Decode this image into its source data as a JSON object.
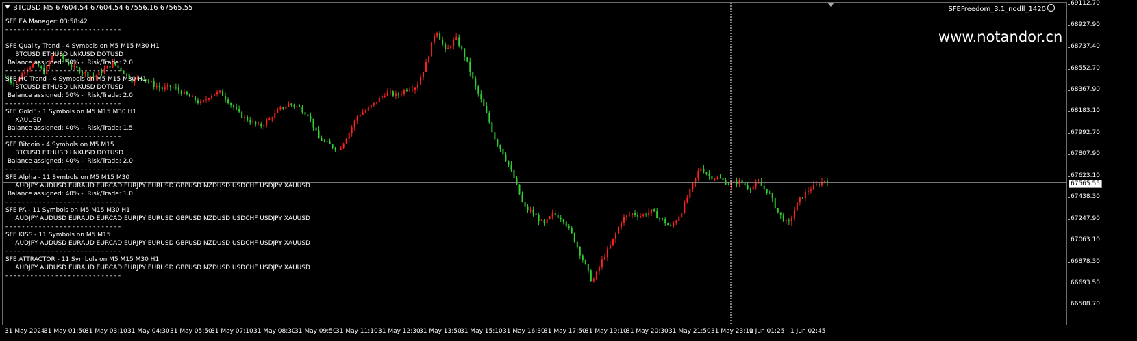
{
  "header": {
    "symbol_line": "BTCUSD,M5  67604.54 67604.54 67556.16 67565.55",
    "ea_name": "SFEFreedom_3.1_nodll_1420"
  },
  "watermark": "www.notandor.cn",
  "info_panel": [
    "SFE EA Manager: 03:58:42",
    "- - - - - - - - - - - - - - - - - - - - - - - - - - - -",
    "",
    "SFE Quality Trend - 4 Symbols on M5 M15 M30 H1",
    "     BTCUSD ETHUSD LNKUSD DOTUSD",
    " Balance assigned: 50% -  Risk/Trade: 2.0",
    "- - - - - - - - - - - - - - - - - - - - - - - - - - - -",
    "SFE HC Trend - 4 Symbols on M5 M15 M30 H1",
    "     BTCUSD ETHUSD LNKUSD DOTUSD",
    " Balance assigned: 50% -  Risk/Trade: 2.0",
    "- - - - - - - - - - - - - - - - - - - - - - - - - - - -",
    "SFE GoldF - 1 Symbols on M5 M15 M30 H1",
    "     XAUUSD",
    " Balance assigned: 40% -  Risk/Trade: 1.5",
    "- - - - - - - - - - - - - - - - - - - - - - - - - - - -",
    "SFE Bitcoin - 4 Symbols on M5 M15",
    "     BTCUSD ETHUSD LNKUSD DOTUSD",
    " Balance assigned: 40% -  Risk/Trade: 2.0",
    "- - - - - - - - - - - - - - - - - - - - - - - - - - - -",
    "SFE Alpha - 11 Symbols on M5 M15 M30",
    "     AUDJPY AUDUSD EURAUD EURCAD EURJPY EURUSD GBPUSD NZDUSD USDCHF USDJPY XAUUSD",
    " Balance assigned: 40% -  Risk/Trade: 1.0",
    "- - - - - - - - - - - - - - - - - - - - - - - - - - - -",
    "SFE PA - 11 Symbols on M5 M15 M30 H1",
    "     AUDJPY AUDUSD EURAUD EURCAD EURJPY EURUSD GBPUSD NZDUSD USDCHF USDJPY XAUUSD",
    "- - - - - - - - - - - - - - - - - - - - - - - - - - - -",
    "SFE KISS - 11 Symbols on M5 M15",
    "     AUDJPY AUDUSD EURAUD EURCAD EURJPY EURUSD GBPUSD NZDUSD USDCHF USDJPY XAUUSD",
    "- - - - - - - - - - - - - - - - - - - - - - - - - - - -",
    "SFE ATTRACTOR - 11 Symbols on M5 M15 M30 H1",
    "     AUDJPY AUDUSD EURAUD EURCAD EURJPY EURUSD GBPUSD NZDUSD USDCHF USDJPY XAUUSD",
    "- - - - - - - - - - - - - - - - - - - - - - - - - - - -"
  ],
  "price_axis": {
    "ticks": [
      "69112.70",
      "68927.90",
      "68737.40",
      "68552.70",
      "68367.90",
      "68183.10",
      "67992.70",
      "67807.90",
      "67623.10",
      "67438.30",
      "67247.90",
      "67063.10",
      "66878.30",
      "66693.50",
      "66508.70"
    ],
    "current_price": "67565.55"
  },
  "time_axis": {
    "ticks": [
      "31 May 2024",
      "31 May 01:50",
      "31 May 03:10",
      "31 May 04:30",
      "31 May 05:50",
      "31 May 07:10",
      "31 May 08:30",
      "31 May 09:50",
      "31 May 11:10",
      "31 May 12:30",
      "31 May 13:50",
      "31 May 15:10",
      "31 May 16:30",
      "31 May 17:50",
      "31 May 19:10",
      "31 May 20:30",
      "31 May 21:50",
      "31 May 23:10",
      "1 Jun 01:25",
      "1 Jun 02:45"
    ]
  },
  "chart_data": {
    "type": "candlestick",
    "symbol": "BTCUSD",
    "timeframe": "M5",
    "ylim": [
      66508.7,
      69112.7
    ],
    "colors": {
      "bull": "#ff2020",
      "bear": "#32cd32",
      "crosshair": "#ffffff",
      "grid": "#888888"
    },
    "close_path": [
      68480,
      68420,
      68550,
      68600,
      68520,
      68700,
      68630,
      68560,
      68520,
      68480,
      68540,
      68600,
      68530,
      68450,
      68480,
      68420,
      68380,
      68400,
      68350,
      68300,
      68250,
      68330,
      68350,
      68250,
      68150,
      68100,
      68050,
      68120,
      68200,
      68250,
      68220,
      68150,
      67950,
      67900,
      67850,
      67980,
      68150,
      68200,
      68280,
      68350,
      68320,
      68380,
      68400,
      68600,
      68900,
      68700,
      68820,
      68650,
      68400,
      68200,
      67950,
      67800,
      67600,
      67350,
      67300,
      67200,
      67300,
      67250,
      67100,
      66900,
      66700,
      66900,
      67050,
      67250,
      67300,
      67280,
      67320,
      67250,
      67180,
      67300,
      67500,
      67700,
      67620,
      67600,
      67550,
      67580,
      67520,
      67560,
      67480,
      67300,
      67200,
      67400,
      67500,
      67550,
      67600
    ],
    "last_ohlc": {
      "open": 67604.54,
      "high": 67604.54,
      "low": 67556.16,
      "close": 67565.55
    }
  }
}
